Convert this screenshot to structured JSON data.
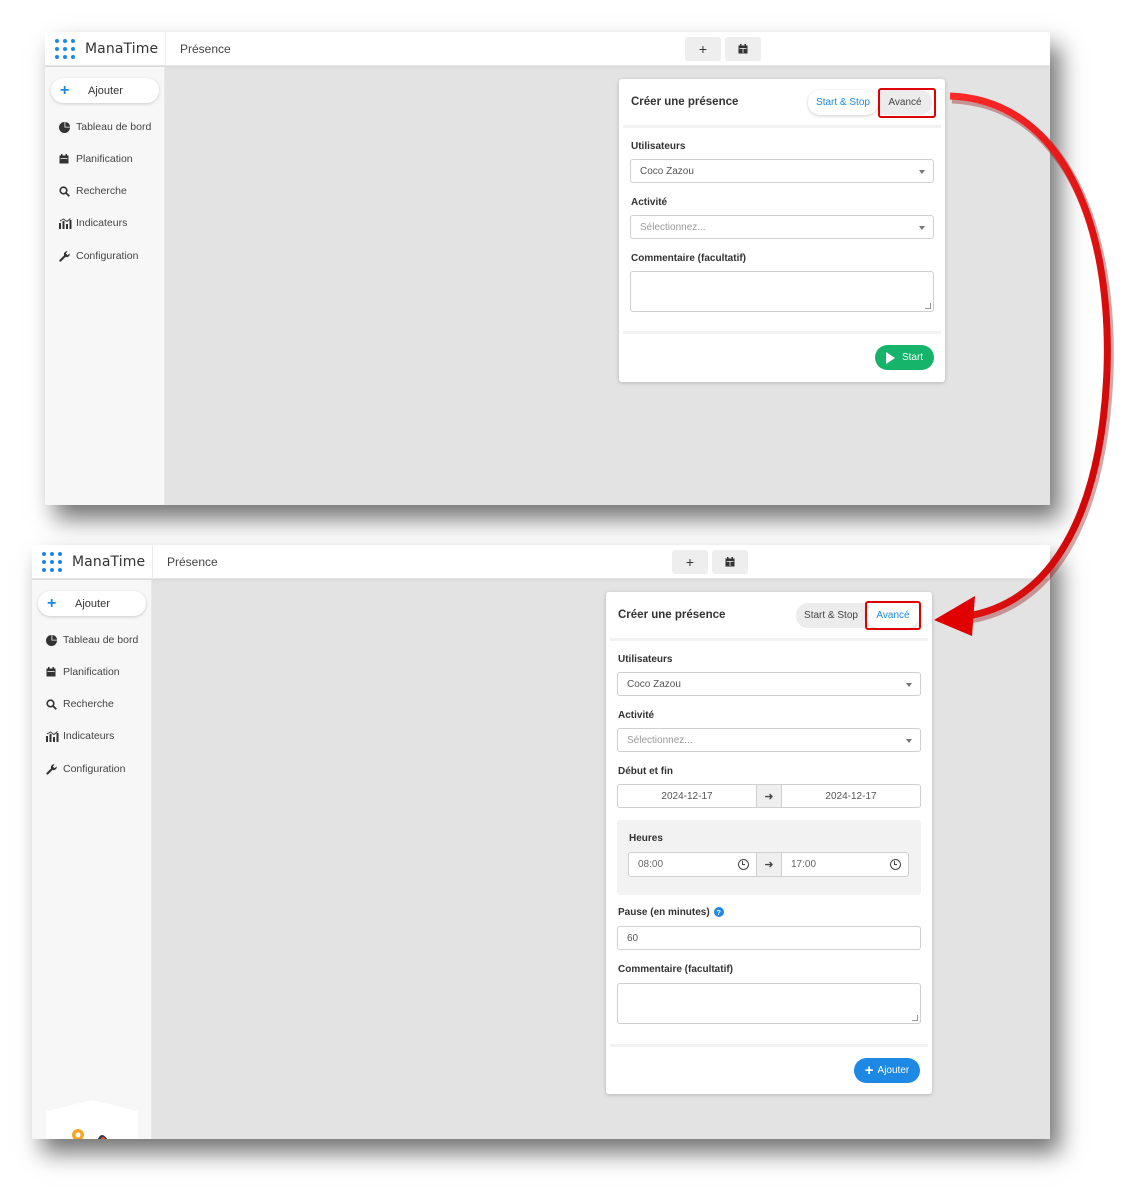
{
  "app": {
    "name": "ManaTime",
    "page_title": "Présence",
    "top_plus": "+",
    "top_calendar_icon": "calendar-icon"
  },
  "sidebar": {
    "add_label": "Ajouter",
    "items": [
      {
        "label": "Tableau de bord",
        "icon": "pie-chart-icon"
      },
      {
        "label": "Planification",
        "icon": "calendar-icon"
      },
      {
        "label": "Recherche",
        "icon": "search-icon"
      },
      {
        "label": "Indicateurs",
        "icon": "bar-chart-icon"
      },
      {
        "label": "Configuration",
        "icon": "wrench-icon"
      }
    ]
  },
  "form_simple": {
    "title": "Créer une présence",
    "tab_start_stop": "Start & Stop",
    "tab_advanced": "Avancé",
    "users_label": "Utilisateurs",
    "users_value": "Coco Zazou",
    "activity_label": "Activité",
    "activity_placeholder": "Sélectionnez...",
    "comment_label": "Commentaire (facultatif)",
    "start_button": "Start"
  },
  "form_advanced": {
    "title": "Créer une présence",
    "tab_start_stop": "Start & Stop",
    "tab_advanced": "Avancé",
    "users_label": "Utilisateurs",
    "users_value": "Coco Zazou",
    "activity_label": "Activité",
    "activity_placeholder": "Sélectionnez...",
    "dates_label": "Début et fin",
    "date_start": "2024-12-17",
    "date_end": "2024-12-17",
    "hours_label": "Heures",
    "time_start": "08:00",
    "time_end": "17:00",
    "pause_label": "Pause (en minutes)",
    "pause_value": "60",
    "comment_label": "Commentaire (facultatif)",
    "add_button": "Ajouter"
  },
  "colors": {
    "accent": "#1e88e5",
    "start_green": "#16b36b",
    "highlight_red": "#e10000"
  }
}
